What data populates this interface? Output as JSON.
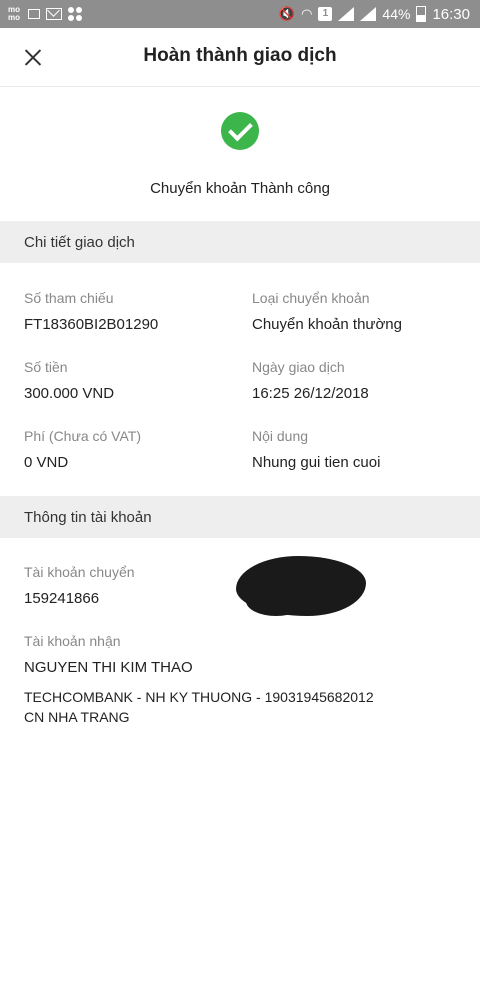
{
  "status_bar": {
    "app_badge": "mo mo",
    "battery": "44%",
    "time": "16:30",
    "sim": "1"
  },
  "header": {
    "title": "Hoàn thành giao dịch"
  },
  "result": {
    "message": "Chuyển khoản Thành công",
    "accent_color": "#3cb54a"
  },
  "transaction_section": {
    "title": "Chi tiết giao dịch",
    "fields": [
      {
        "label": "Số tham chiếu",
        "value": "FT18360BI2B01290"
      },
      {
        "label": "Loại chuyển khoản",
        "value": "Chuyển khoản thường"
      },
      {
        "label": "Số tiền",
        "value": "300.000 VND"
      },
      {
        "label": "Ngày giao dịch",
        "value": "16:25 26/12/2018"
      },
      {
        "label": "Phí (Chưa có VAT)",
        "value": "0 VND"
      },
      {
        "label": "Nội dung",
        "value": "Nhung gui tien cuoi"
      }
    ]
  },
  "account_section": {
    "title": "Thông tin tài khoản",
    "sender": {
      "label": "Tài khoản chuyển",
      "value": "159241866"
    },
    "receiver": {
      "label": "Tài khoản nhận",
      "name": "NGUYEN THI KIM THAO",
      "bank_line1": "TECHCOMBANK - NH KY THUONG - 19031945682012",
      "bank_line2": "CN NHA TRANG"
    }
  }
}
